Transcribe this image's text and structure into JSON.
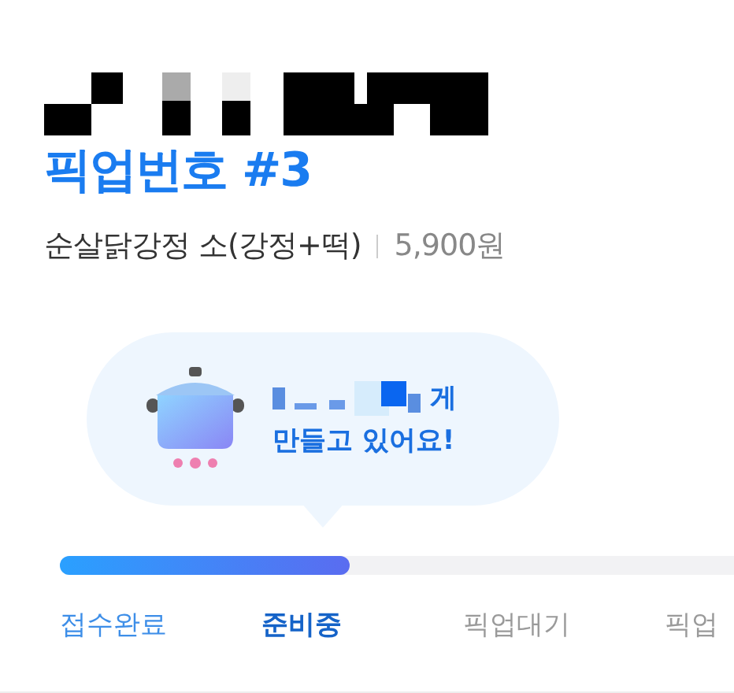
{
  "pickup_title": "픽업번호 #3",
  "order": {
    "item": "순살닭강정 소(강정+떡)",
    "price": "5,900원"
  },
  "status_bubble": {
    "line_1_tail": "게",
    "line_2": "만들고 있어요!"
  },
  "progress": {
    "level": 0.4
  },
  "steps": [
    {
      "label": "접수완료",
      "done": true,
      "selected": false
    },
    {
      "label": "준비중",
      "done": false,
      "selected": true
    },
    {
      "label": "픽업대기",
      "done": false,
      "selected": false
    },
    {
      "label": "픽업",
      "done": false,
      "selected": false
    }
  ]
}
